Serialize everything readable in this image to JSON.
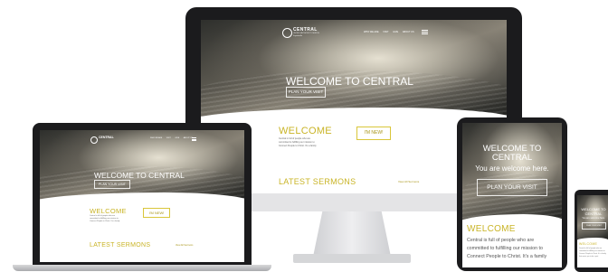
{
  "site": {
    "brand_name": "CENTRAL",
    "brand_sub": "UNITED METHODIST CHURCH",
    "brand_loc": "Fayetteville",
    "nav": [
      "WHO WE ARE",
      "VISIT",
      "GIVE",
      "ABOUT US"
    ],
    "hamburger_icon": "hamburger-menu-icon",
    "logo_icon": "church-cross-logo-icon"
  },
  "hero": {
    "title": "WELCOME TO CENTRAL",
    "subtitle": "You are welcome here.",
    "button": "PLAN YOUR VISIT"
  },
  "welcome": {
    "heading": "WELCOME",
    "button": "I'M NEW!",
    "text_1": "Central is full of people who are",
    "text_2": "committed to fulfilling our mission to",
    "text_3": "Connect People to Christ. It's a family",
    "text_4": "that wants you to be a part."
  },
  "sermons": {
    "heading": "LATEST SERMONS",
    "link": "View All Sermons"
  },
  "colors": {
    "accent": "#c9b426",
    "device_frame": "#1b1b1d"
  }
}
